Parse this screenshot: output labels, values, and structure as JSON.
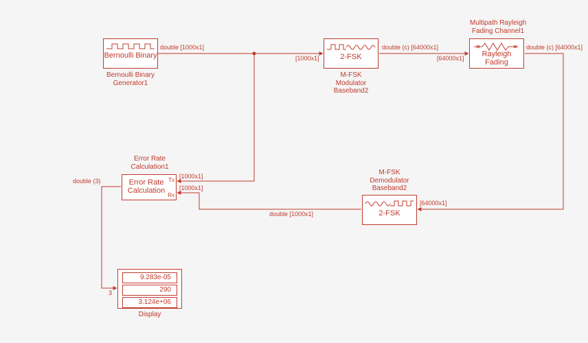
{
  "colors": {
    "stroke": "#c0392b",
    "bg": "#f5f5f5",
    "block_bg": "#ffffff"
  },
  "blocks": {
    "bernoulli": {
      "title": "Bernoulli\nBinary",
      "label": "Bernoulli Binary\nGenerator1"
    },
    "modulator": {
      "title": "2-FSK",
      "label": "M-FSK\nModulator\nBaseband2"
    },
    "channel": {
      "title": "Rayleigh\nFading",
      "label": "Multipath Rayleigh\nFading Channel1"
    },
    "demodulator": {
      "title": "2-FSK",
      "label": "M-FSK\nDemodulator\nBaseband2"
    },
    "errorrate": {
      "title": "Error Rate\nCalculation",
      "label": "Error Rate\nCalculation1",
      "port_tx": "Tx",
      "port_rx": "Rx"
    },
    "display": {
      "label": "Display",
      "values": [
        "9.283e-05",
        "290",
        "3.124e+06"
      ]
    }
  },
  "signals": {
    "bern_out": "double [1000x1]",
    "mod_in": "[1000x1]",
    "mod_out": "double (c) [64000x1]",
    "chan_in": "[64000x1]",
    "chan_out": "double (c) [64000x1]",
    "demod_in": "[64000x1]",
    "demod_out": "double [1000x1]",
    "err_tx": "[1000x1]",
    "err_rx": "[1000x1]",
    "err_out": "double (3)",
    "disp_in": "3"
  }
}
